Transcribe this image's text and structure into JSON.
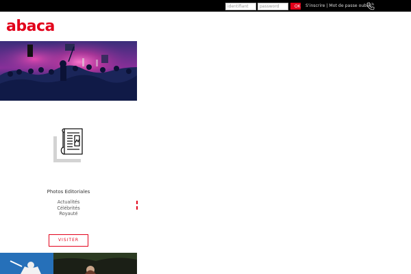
{
  "header": {
    "login_placeholder": "identifiant",
    "password_placeholder": "password",
    "ok_label": "OK",
    "signup_label": "S'inscrire",
    "separator": "|",
    "forgot_label": "Mot de passe oublié"
  },
  "brand": {
    "logo_text": "abaca",
    "accent_color": "#e2001a"
  },
  "category": {
    "title": "Photos Editoriales",
    "items": [
      "Actualités",
      "Célébrités",
      "Royauté"
    ],
    "visit_label": "VISITER"
  },
  "icons": {
    "phone": "phone-icon",
    "newspaper": "newspaper-icon"
  }
}
